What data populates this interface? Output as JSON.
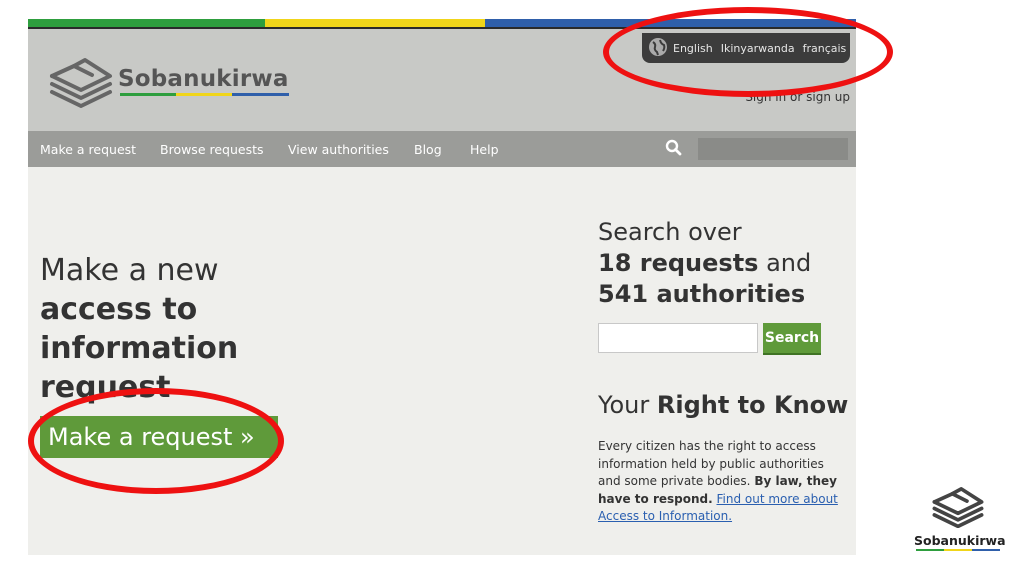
{
  "header": {
    "logo_text": "Sobanukirwa",
    "languages": [
      "English",
      "Ikinyarwanda",
      "français"
    ],
    "signin_label": "Sign in or sign up"
  },
  "nav": {
    "items": [
      "Make a request",
      "Browse requests",
      "View authorities",
      "Blog",
      "Help"
    ]
  },
  "hero": {
    "line1": "Make a new",
    "line2": "access to",
    "line3": "information",
    "line4": "request",
    "button_label": "Make a request »"
  },
  "search": {
    "line1": "Search over",
    "requests_count": "18 requests",
    "and": "and",
    "authorities_count": "541 authorities",
    "button_label": "Search"
  },
  "right_to_know": {
    "title_prefix": "Your",
    "title_bold": "Right to Know",
    "body": "Every citizen has the right to access information held by public authorities and some private bodies.",
    "body_bold": "By law, they have to respond.",
    "link_text": "Find out more about Access to Information."
  },
  "watermark": {
    "text": "Sobanukirwa"
  },
  "colors": {
    "stripe_green": "#2e9e3e",
    "stripe_yellow": "#f0d51a",
    "stripe_blue": "#2f5faa",
    "button_green": "#5f9a3a",
    "annotation_red": "#ee1111"
  }
}
